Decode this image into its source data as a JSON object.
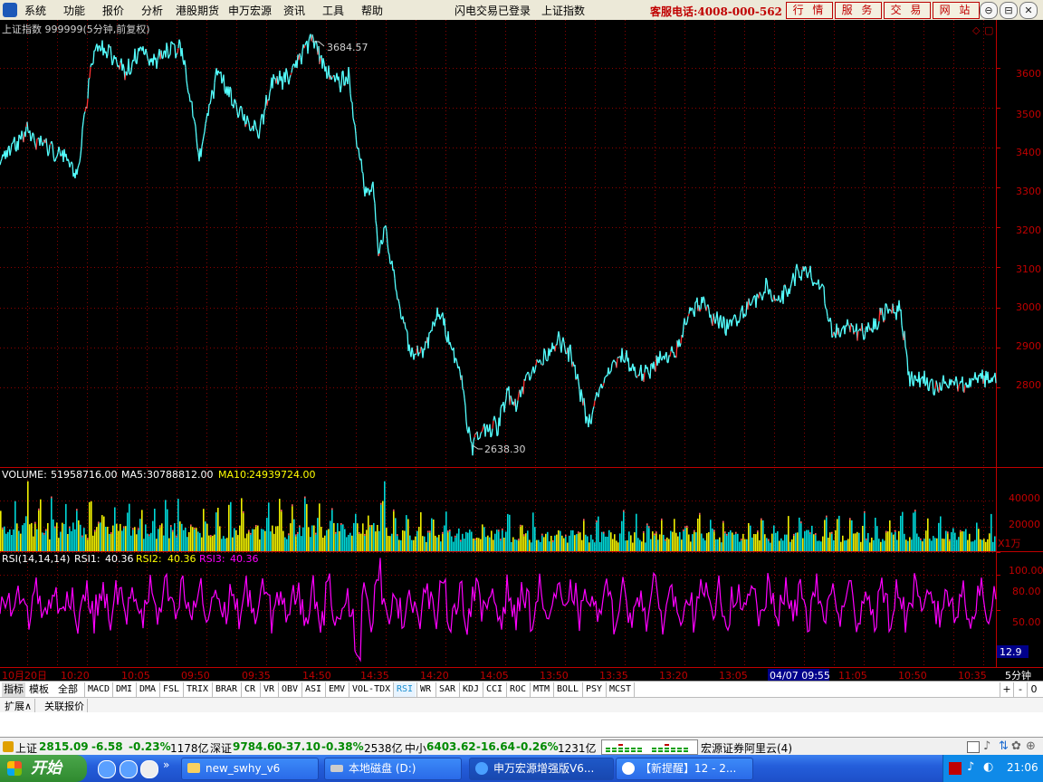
{
  "menubar": {
    "items": [
      "系统",
      "功能",
      "报价",
      "分析",
      "港股期货",
      "申万宏源",
      "资讯",
      "工具",
      "帮助"
    ],
    "status_login": "闪电交易已登录",
    "status_index": "上证指数",
    "hotline": "客服电话:4008-000-562",
    "buttons": [
      "行 情",
      "服 务",
      "交 易",
      "网 站"
    ],
    "window_buttons": [
      "⊖",
      "⊟",
      "✕"
    ]
  },
  "price_panel": {
    "header": "上证指数 999999(5分钟,前复权)",
    "high_label": "3684.57",
    "low_label": "2638.30",
    "y_ticks": [
      "3600",
      "3500",
      "3400",
      "3300",
      "3200",
      "3100",
      "3000",
      "2900",
      "2800"
    ]
  },
  "volume_panel": {
    "label": "VOLUME:",
    "volume": "51958716.00",
    "ma5_label": "MA5:",
    "ma5": "30788812.00",
    "ma10_label": "MA10:",
    "ma10": "24939724.00",
    "y_ticks": [
      "40000",
      "20000"
    ],
    "unit": "X1万"
  },
  "rsi_panel": {
    "label": "RSI(14,14,14)",
    "rsi1_label": "RSI1:",
    "rsi1": "40.36",
    "rsi2_label": "RSI2:",
    "rsi2": "40.36",
    "rsi3_label": "RSI3:",
    "rsi3": "40.36",
    "y_ticks": [
      "100.00",
      "80.00",
      "50.00"
    ],
    "current": "12.9"
  },
  "x_axis": {
    "labels": [
      "10月20日",
      "10:20",
      "10:05",
      "09:50",
      "09:35",
      "14:50",
      "14:35",
      "14:20",
      "14:05",
      "13:50",
      "13:35",
      "13:20",
      "13:05",
      "04/07 09:55",
      "11:05",
      "10:50",
      "10:35"
    ],
    "period": "5分钟"
  },
  "tabs": {
    "main": [
      "指标",
      "模板",
      "全部"
    ],
    "indicators": [
      "MACD",
      "DMI",
      "DMA",
      "FSL",
      "TRIX",
      "BRAR",
      "CR",
      "VR",
      "OBV",
      "ASI",
      "EMV",
      "VOL-TDX",
      "RSI",
      "WR",
      "SAR",
      "KDJ",
      "CCI",
      "ROC",
      "MTM",
      "BOLL",
      "PSY",
      "MCST"
    ],
    "active_indicator": "RSI",
    "right_controls": [
      "+",
      "-",
      "0"
    ]
  },
  "subtabs": [
    "扩展∧",
    "关联报价"
  ],
  "statusbar": {
    "sh_name": "上证",
    "sh_price": "2815.09",
    "sh_chg": "-6.58",
    "sh_pct": "-0.23%",
    "sh_amt": "1178亿",
    "sz_name": "深证",
    "sz_price": "9784.60",
    "sz_chg": "-37.10",
    "sz_pct": "-0.38%",
    "sz_amt": "2538亿",
    "zx_name": "中小",
    "zx_price": "6403.62",
    "zx_chg": "-16.64",
    "zx_pct": "-0.26%",
    "zx_amt": "1231亿",
    "broker": "宏源证券阿里云(4)"
  },
  "taskbar": {
    "start": "开始",
    "tasks": [
      "new_swhy_v6",
      "本地磁盘 (D:)",
      "申万宏源增强版V6...",
      "【新提醒】12 - 2..."
    ],
    "clock": "21:06"
  },
  "colors": {
    "up": "#ff3232",
    "down": "#54ffff",
    "grid": "#8b0000",
    "axis": "#c00000",
    "rsi": "#ff00ff",
    "ma5": "#ffffff",
    "ma10": "#ffff00",
    "vol_base": "#00d8d8"
  },
  "chart_data": [
    {
      "type": "line",
      "title": "上证指数 999999(5分钟,前复权)",
      "x_ticks": [
        "10月20日",
        "10:20",
        "10:05",
        "09:50",
        "09:35",
        "14:50",
        "14:35",
        "14:20",
        "14:05",
        "13:50",
        "13:35",
        "13:20",
        "13:05",
        "04/07 09:55",
        "11:05",
        "10:50",
        "10:35"
      ],
      "ylim": [
        2600,
        3720
      ],
      "anchors": [
        [
          0,
          3370
        ],
        [
          30,
          3440
        ],
        [
          50,
          3400
        ],
        [
          70,
          3380
        ],
        [
          85,
          3330
        ],
        [
          95,
          3510
        ],
        [
          105,
          3650
        ],
        [
          120,
          3640
        ],
        [
          140,
          3590
        ],
        [
          155,
          3650
        ],
        [
          170,
          3610
        ],
        [
          185,
          3640
        ],
        [
          200,
          3650
        ],
        [
          210,
          3530
        ],
        [
          220,
          3380
        ],
        [
          240,
          3590
        ],
        [
          260,
          3510
        ],
        [
          285,
          3430
        ],
        [
          300,
          3560
        ],
        [
          320,
          3580
        ],
        [
          335,
          3640
        ],
        [
          345,
          3680
        ],
        [
          355,
          3620
        ],
        [
          365,
          3580
        ],
        [
          375,
          3560
        ],
        [
          385,
          3580
        ],
        [
          395,
          3400
        ],
        [
          405,
          3280
        ],
        [
          412,
          3320
        ],
        [
          418,
          3130
        ],
        [
          425,
          3200
        ],
        [
          440,
          3010
        ],
        [
          455,
          2880
        ],
        [
          470,
          2900
        ],
        [
          485,
          2990
        ],
        [
          500,
          2900
        ],
        [
          510,
          2820
        ],
        [
          520,
          2650
        ],
        [
          535,
          2700
        ],
        [
          550,
          2700
        ],
        [
          560,
          2790
        ],
        [
          570,
          2760
        ],
        [
          585,
          2840
        ],
        [
          600,
          2870
        ],
        [
          615,
          2920
        ],
        [
          630,
          2880
        ],
        [
          640,
          2800
        ],
        [
          650,
          2700
        ],
        [
          660,
          2780
        ],
        [
          675,
          2850
        ],
        [
          690,
          2880
        ],
        [
          700,
          2840
        ],
        [
          715,
          2830
        ],
        [
          725,
          2870
        ],
        [
          740,
          2870
        ],
        [
          750,
          2900
        ],
        [
          760,
          2990
        ],
        [
          775,
          3010
        ],
        [
          790,
          2970
        ],
        [
          805,
          2950
        ],
        [
          815,
          2980
        ],
        [
          830,
          3010
        ],
        [
          845,
          3050
        ],
        [
          855,
          3020
        ],
        [
          870,
          3040
        ],
        [
          880,
          3090
        ],
        [
          895,
          3080
        ],
        [
          910,
          3030
        ],
        [
          920,
          2930
        ],
        [
          935,
          2950
        ],
        [
          950,
          2940
        ],
        [
          965,
          2950
        ],
        [
          980,
          3000
        ],
        [
          995,
          2990
        ],
        [
          1005,
          2820
        ],
        [
          1020,
          2820
        ],
        [
          1035,
          2800
        ],
        [
          1050,
          2810
        ],
        [
          1065,
          2800
        ],
        [
          1080,
          2830
        ],
        [
          1100,
          2815
        ]
      ],
      "annotations": [
        {
          "text": "3684.57",
          "value": 3684.57
        },
        {
          "text": "2638.30",
          "value": 2638.3
        }
      ]
    },
    {
      "type": "bar",
      "title": "VOLUME",
      "unit": "X1万",
      "ylim": [
        0,
        50000
      ],
      "ma5": 30788812.0,
      "ma10": 24939724.0
    },
    {
      "type": "line",
      "title": "RSI(14,14,14)",
      "ylim": [
        0,
        100
      ],
      "series": [
        {
          "name": "RSI1",
          "last": 40.36
        },
        {
          "name": "RSI2",
          "last": 40.36
        },
        {
          "name": "RSI3",
          "last": 40.36
        }
      ]
    }
  ]
}
